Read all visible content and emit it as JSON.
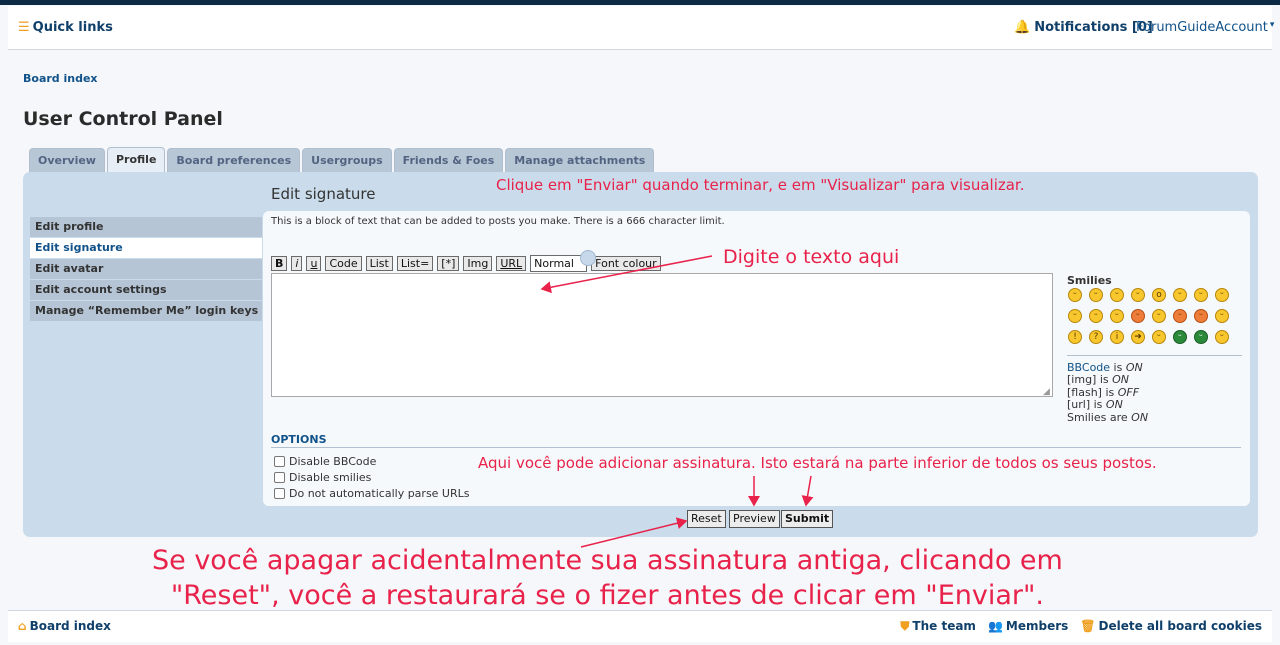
{
  "navbar": {
    "quick_links": "Quick links",
    "notifications": "Notifications [0]",
    "account": "ForumGuideAccount"
  },
  "breadcrumb": "Board index",
  "page_title": "User Control Panel",
  "tabs": [
    {
      "label": "Overview"
    },
    {
      "label": "Profile"
    },
    {
      "label": "Board preferences"
    },
    {
      "label": "Usergroups"
    },
    {
      "label": "Friends & Foes"
    },
    {
      "label": "Manage attachments"
    }
  ],
  "active_tab": "Profile",
  "sidebar": {
    "items": [
      {
        "label": "Edit profile"
      },
      {
        "label": "Edit signature"
      },
      {
        "label": "Edit avatar"
      },
      {
        "label": "Edit account settings"
      },
      {
        "label": "Manage “Remember Me” login keys"
      }
    ],
    "active": "Edit signature"
  },
  "section_title": "Edit signature",
  "intro_text": "This is a block of text that can be added to posts you make. There is a 666 character limit.",
  "toolbar": {
    "bold": "B",
    "italic": "i",
    "underline": "u",
    "code": "Code",
    "list": "List",
    "list_item_eq": "List=",
    "list_star": "[*]",
    "img": "Img",
    "url": "URL",
    "font_size": "Normal",
    "font_colour": "Font colour"
  },
  "editor": {
    "value": ""
  },
  "smilies": {
    "title": "Smilies",
    "count": 24
  },
  "bbcode_status": {
    "bbcode_link": "BBCode",
    "bbcode_mid": " is ",
    "bbcode_state": "ON",
    "img_label": "[img] is ",
    "img_state": "ON",
    "flash_label": "[flash] is ",
    "flash_state": "OFF",
    "url_label": "[url] is ",
    "url_state": "ON",
    "smilies_label": "Smilies are ",
    "smilies_state": "ON"
  },
  "options": {
    "title": "OPTIONS",
    "items": [
      {
        "label": "Disable BBCode",
        "checked": false
      },
      {
        "label": "Disable smilies",
        "checked": false
      },
      {
        "label": "Do not automatically parse URLs",
        "checked": false
      }
    ]
  },
  "buttons": {
    "reset": "Reset",
    "preview": "Preview",
    "submit": "Submit"
  },
  "annotations": {
    "top": "Clique em \"Enviar\" quando terminar, e em \"Visualizar\" para visualizar.",
    "editor": "Digite o texto aqui",
    "signature": "Aqui você pode adicionar assinatura. Isto estará na parte inferior de todos os seus postos.",
    "reset_line1": "Se você apagar acidentalmente sua assinatura antiga, clicando em",
    "reset_line2": "\"Reset\", você a restaurará se o fizer antes de clicar em \"Enviar\"."
  },
  "footer": {
    "board_index": "Board index",
    "team": "The team",
    "members": "Members",
    "delete_cookies": "Delete all board cookies"
  },
  "colors": {
    "accent": "#105289",
    "panel": "#cadceb",
    "annotation": "#e8224a",
    "icon_orange": "#f0a020"
  }
}
